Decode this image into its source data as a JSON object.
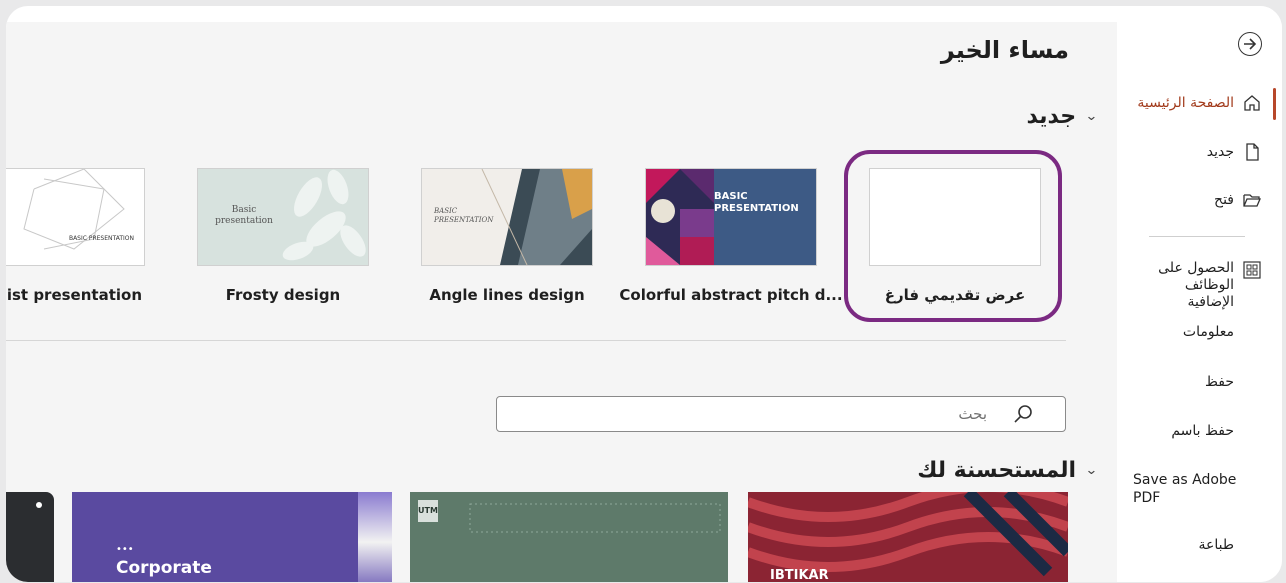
{
  "greeting": "مساء الخير",
  "new_section": {
    "title": "جديد",
    "templates": [
      {
        "label": "عرض تقديمي فارغ",
        "thumb": "blank"
      },
      {
        "label": "Colorful abstract pitch d...",
        "thumb": "colorful",
        "thumb_text": "BASIC PRESENTATION"
      },
      {
        "label": "Angle lines design",
        "thumb": "angle",
        "thumb_text": "BASIC PRESENTATION"
      },
      {
        "label": "Frosty design",
        "thumb": "frosty",
        "thumb_text": "Basic presentation"
      },
      {
        "label": "malist presentation",
        "thumb": "minimal",
        "thumb_text": "BASIC PRESENTATION"
      }
    ]
  },
  "search": {
    "placeholder": "بحث",
    "icon": "search-icon"
  },
  "featured_section": {
    "title": "المستحسنة لك",
    "cards": [
      {
        "label": "IBTIKAR",
        "color": "#8b2433"
      },
      {
        "label": "UTM",
        "color": "#5e7a6a"
      },
      {
        "label": "Corporate",
        "color": "#5a4aa0"
      },
      {
        "label": "",
        "color": "#2b2d30"
      }
    ]
  },
  "sidebar": {
    "back_icon": "back-arrow-icon",
    "items": [
      {
        "label": "الصفحة الرئيسية",
        "icon": "home-icon",
        "active": true
      },
      {
        "label": "جديد",
        "icon": "new-file-icon"
      },
      {
        "label": "فتح",
        "icon": "folder-open-icon"
      },
      {
        "label": "الحصول على الوظائف الإضافية",
        "icon": "add-ins-icon"
      },
      {
        "label": "معلومات"
      },
      {
        "label": "حفظ"
      },
      {
        "label": "حفظ باسم"
      },
      {
        "label": "Save as Adobe PDF"
      },
      {
        "label": "طباعة"
      }
    ]
  },
  "colors": {
    "accent": "#b7472a",
    "highlight": "#7b2a82"
  }
}
